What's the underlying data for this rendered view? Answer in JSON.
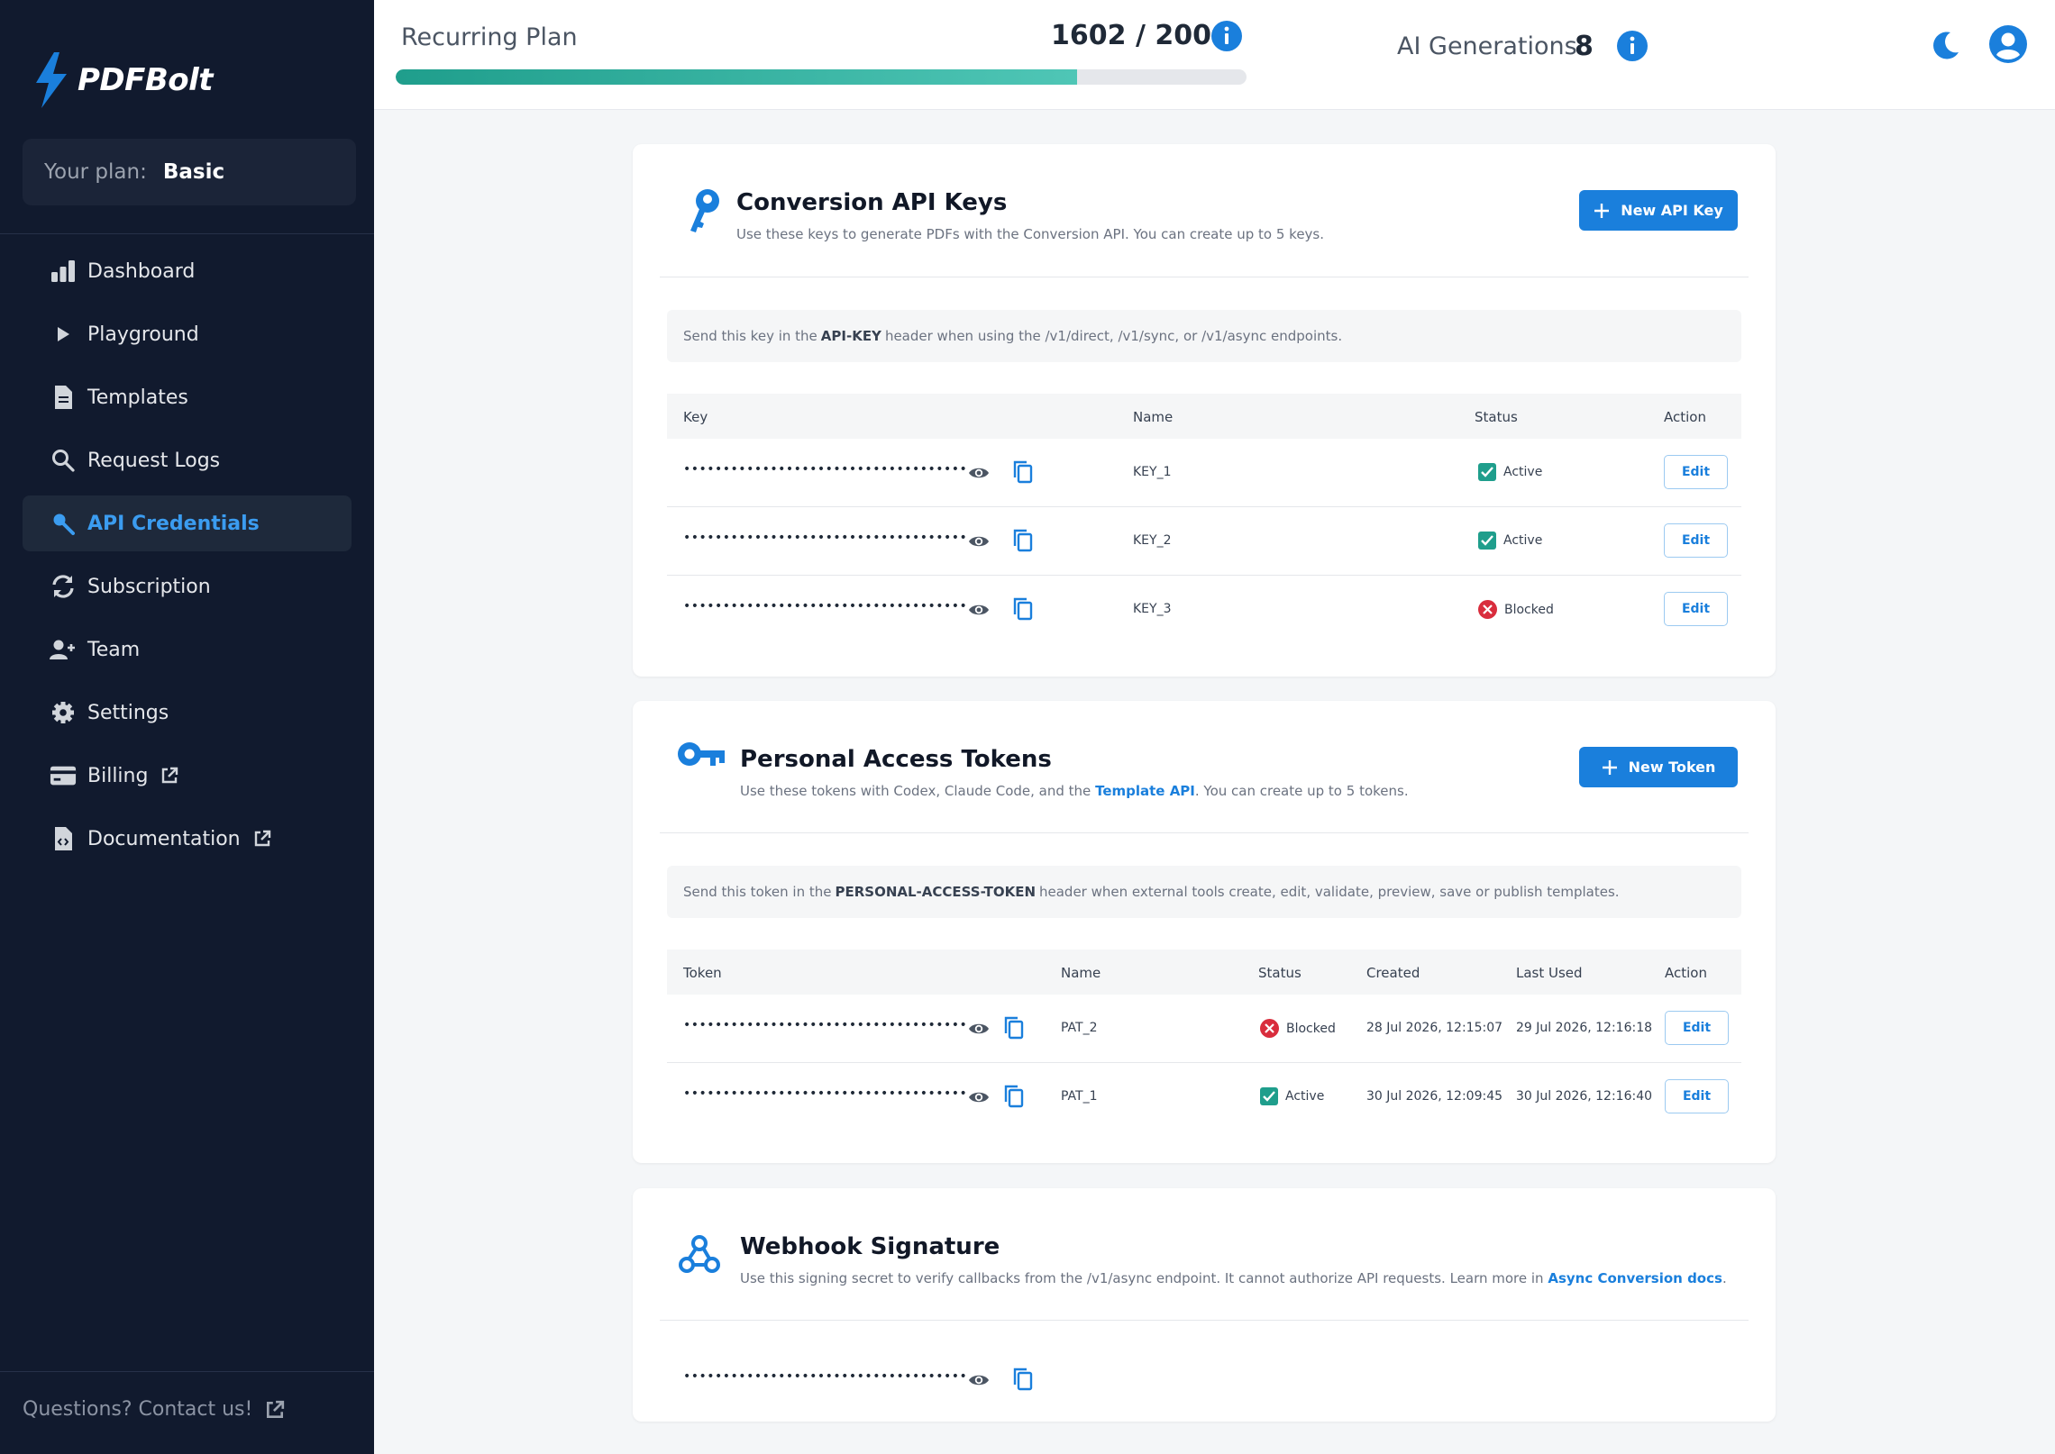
{
  "sidebar": {
    "logo_text": "PDFBolt",
    "plan_label": "Your plan:",
    "plan_value": "Basic",
    "items": [
      {
        "label": "Dashboard"
      },
      {
        "label": "Playground"
      },
      {
        "label": "Templates"
      },
      {
        "label": "Request Logs"
      },
      {
        "label": "API Credentials"
      },
      {
        "label": "Subscription"
      },
      {
        "label": "Team"
      },
      {
        "label": "Settings"
      },
      {
        "label": "Billing"
      },
      {
        "label": "Documentation"
      }
    ],
    "contact": "Questions? Contact us!"
  },
  "header": {
    "plan_label": "Recurring Plan",
    "usage": "1602 / 2000",
    "usage_fraction": 0.801,
    "ai_label": "AI Generations",
    "ai_count": "8"
  },
  "api_keys": {
    "title": "Conversion API Keys",
    "subtitle": "Use these keys to generate PDFs with the Conversion API. You can create up to 5 keys.",
    "new_button": "New API Key",
    "note_before": "Send this key in the",
    "note_bold": "API-KEY",
    "note_after": "header when using the /v1/direct, /v1/sync, or /v1/async endpoints.",
    "columns": [
      "Key",
      "Name",
      "Status",
      "Action"
    ],
    "rows": [
      {
        "key": "••••••••••••••••••••••••••••••••••••",
        "name": "KEY_1",
        "status": "Active",
        "action": "Edit"
      },
      {
        "key": "••••••••••••••••••••••••••••••••••••",
        "name": "KEY_2",
        "status": "Active",
        "action": "Edit"
      },
      {
        "key": "••••••••••••••••••••••••••••••••••••",
        "name": "KEY_3",
        "status": "Blocked",
        "action": "Edit"
      }
    ]
  },
  "tokens": {
    "title": "Personal Access Tokens",
    "subtitle_before": "Use these tokens with Codex, Claude Code, and the",
    "subtitle_link": "Template API",
    "subtitle_after": ". You can create up to 5 tokens.",
    "new_button": "New Token",
    "note_before": "Send this token in the",
    "note_bold": "PERSONAL-ACCESS-TOKEN",
    "note_after": "header when external tools create, edit, validate, preview, save or publish templates.",
    "columns": [
      "Token",
      "Name",
      "Status",
      "Created",
      "Last Used",
      "Action"
    ],
    "rows": [
      {
        "token": "••••••••••••••••••••••••••••••••••••",
        "name": "PAT_2",
        "status": "Blocked",
        "created": "28 Jul 2026, 12:15:07",
        "last_used": "29 Jul 2026, 12:16:18",
        "action": "Edit"
      },
      {
        "token": "••••••••••••••••••••••••••••••••••••",
        "name": "PAT_1",
        "status": "Active",
        "created": "30 Jul 2026, 12:09:45",
        "last_used": "30 Jul 2026, 12:16:40",
        "action": "Edit"
      }
    ]
  },
  "webhook": {
    "title": "Webhook Signature",
    "subtitle_before": "Use this signing secret to verify callbacks from the /v1/async endpoint. It cannot authorize API requests. Learn more in",
    "subtitle_link": "Async Conversion docs",
    "subtitle_after": ".",
    "secret": "••••••••••••••••••••••••••••••••••••"
  },
  "colors": {
    "sidebar_bg": "#111a2e",
    "accent": "#1a7fdc",
    "active": "#1f9e8c",
    "blocked": "#d92d3d"
  }
}
